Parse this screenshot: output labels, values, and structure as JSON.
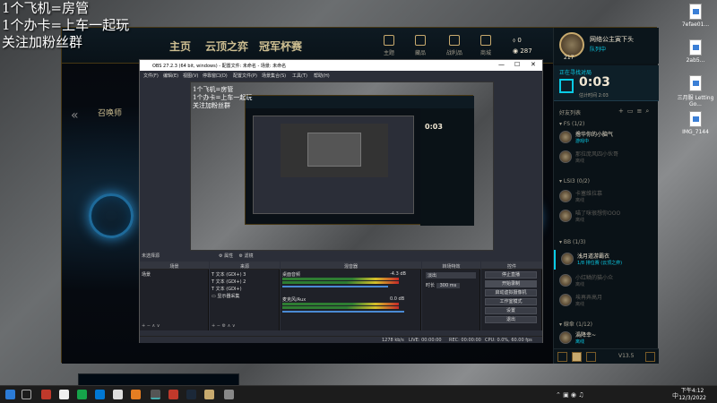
{
  "overlay": {
    "line1": "1个飞机=房管",
    "line2": "1个办卡=上车一起玩",
    "line3": "关注加粉丝群"
  },
  "desktop_icons": [
    {
      "label": "7efae01..."
    },
    {
      "label": "2ab5..."
    },
    {
      "label": "三月服 Letting Go..."
    },
    {
      "label": "IMG_7144"
    }
  ],
  "client": {
    "nav": [
      "主页",
      "云顶之弈",
      "冠军杯赛"
    ],
    "nav_icons": [
      {
        "icon": "user-icon",
        "label": "主题"
      },
      {
        "icon": "hat-icon",
        "label": "藏品"
      },
      {
        "icon": "tools-icon",
        "label": "战利品"
      },
      {
        "icon": "shop-icon",
        "label": "商城"
      }
    ],
    "currency": {
      "be": "0",
      "rp": "287"
    },
    "game_label": "召唤师",
    "profile": {
      "name": "网络公主寅下头",
      "status": "队列中",
      "level": "217"
    },
    "queue": {
      "title": "正在寻找对局",
      "time": "0:03",
      "estimate_label": "估计时间",
      "estimate": "2:03"
    },
    "friends_header": "好友列表",
    "groups": [
      {
        "name": "FS (1/2)",
        "friends": [
          {
            "name": "撸华你的小脑气",
            "status": "游戏中",
            "online": true
          },
          {
            "name": "那拉庞风四小伙哥",
            "status": "离线",
            "online": false
          }
        ]
      },
      {
        "name": "LSI3 (0/2)",
        "friends": [
          {
            "name": "卡塞维拉慕",
            "status": "离线",
            "online": false
          },
          {
            "name": "喵了咪很想你OOO",
            "status": "离线",
            "online": false
          }
        ]
      },
      {
        "name": "BB (1/3)",
        "friends": [
          {
            "name": "浅月道游霸衣",
            "status": "1/8 排位赛 (云顶之弈)",
            "online": true
          },
          {
            "name": "小红鳞的猫小众",
            "status": "离线",
            "online": false
          },
          {
            "name": "埃再弄高月",
            "status": "离线",
            "online": false
          }
        ]
      },
      {
        "name": "線傘 (1/12)",
        "friends": [
          {
            "name": "渦降幸~",
            "status": "离线",
            "online": true
          }
        ]
      }
    ],
    "version": "V13.5"
  },
  "obs": {
    "title": "OBS 27.2.3 (64 bit, windows) - 配置文件: 未命名 - 场景: 未命名",
    "menu": [
      "文件(F)",
      "编辑(E)",
      "视图(V)",
      "停靠窗口(D)",
      "配置文件(P)",
      "场景集合(S)",
      "工具(T)",
      "帮助(H)"
    ],
    "preview_overlay": [
      "1个飞机=房管",
      "1个办卡=上车一起玩",
      "关注加粉丝群"
    ],
    "preview_time": "0:03",
    "scene_label": "未选择源",
    "toolbar": [
      "属性",
      "滤镜"
    ],
    "headers": [
      "场景",
      "来源",
      "混音器",
      "转场特效",
      "控件"
    ],
    "scenes": [
      "场景"
    ],
    "sources": [
      "文本 (GDI+) 3",
      "文本 (GDI+) 2",
      "文本 (GDI+)",
      "显示器采集"
    ],
    "mixer": [
      {
        "name": "桌面音频",
        "db": "-4.3 dB"
      },
      {
        "name": "麦克风/Aux",
        "db": "0.0 dB"
      }
    ],
    "transition": {
      "type": "淡出",
      "duration_label": "时长",
      "duration": "300 ms"
    },
    "controls": [
      "停止直播",
      "开始录制",
      "启动虚拟摄像机",
      "工作室模式",
      "设置",
      "退出"
    ],
    "status": {
      "live": "LIVE: 00:00:00",
      "rec": "REC: 00:00:00",
      "cpu": "CPU: 0.0%, 60.00 fps",
      "bitrate": "1278 kb/s"
    }
  },
  "taskbar": {
    "time": "下午4:12",
    "date": "12/3/2022",
    "lang": "中"
  }
}
